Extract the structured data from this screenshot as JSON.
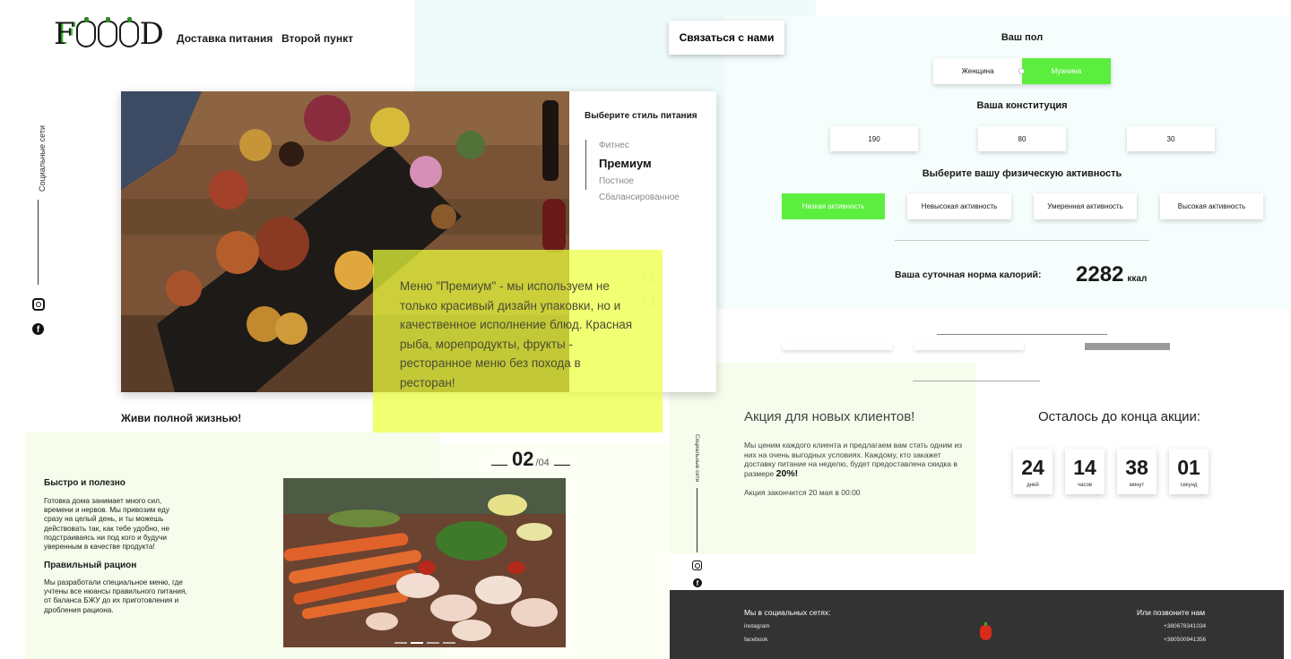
{
  "header": {
    "logo_text_f": "F",
    "logo_text_d": "D",
    "nav": [
      "Доставка питания",
      "Второй пункт"
    ],
    "contact_button": "Связаться с нами"
  },
  "social": {
    "label": "Социальные сети",
    "instagram_icon": "instagram-icon",
    "facebook_icon": "facebook-icon",
    "facebook_glyph": "f"
  },
  "hero": {
    "image": "food-platter-photo",
    "style_title": "Выберите стиль питания",
    "styles": [
      {
        "label": "Фитнес",
        "active": false
      },
      {
        "label": "Премиум",
        "active": true
      },
      {
        "label": "Постное",
        "active": false
      },
      {
        "label": "Сбалансированное",
        "active": false
      }
    ],
    "description": "Меню \"Премиум\" - мы используем не только красивый дизайн упаковки, но и качественное исполнение блюд. Красная рыба, морепродукты, фрукты - ресторанное меню без похода в ресторан!",
    "tagline": "Живи полной жизнью!"
  },
  "features": {
    "counter_current": "02",
    "counter_total": "/04",
    "items": [
      {
        "title": "Быстро и полезно",
        "text": "Готовка дома занимает много сил, времени и нервов. Мы привозим еду сразу на целый день, и ты можешь действовать так, как тебе удобно, не подстраиваясь ни под кого и будучи уверенным в качестве продукта!"
      },
      {
        "title": "Правильный рацион",
        "text": "Мы разработали специальное меню, где учтены все нюансы правильного питания, от баланса БЖУ до их приготовления и дробления рациона."
      }
    ],
    "image": "vegetables-photo",
    "slider_dots": 4,
    "slider_active": 2
  },
  "calculator": {
    "gender_label": "Ваш пол",
    "gender_options": [
      {
        "label": "Женщина",
        "selected": false
      },
      {
        "label": "Мужчина",
        "selected": true
      }
    ],
    "constitution_label": "Ваша конституция",
    "height": "190",
    "weight": "80",
    "age": "30",
    "activity_label": "Выберите вашу физическую активность",
    "activities": [
      {
        "label": "Низкая активность",
        "selected": true
      },
      {
        "label": "Невысокая активность",
        "selected": false
      },
      {
        "label": "Умеренная активность",
        "selected": false
      },
      {
        "label": "Высокая активность",
        "selected": false
      }
    ],
    "result_label": "Ваша суточная норма калорий:",
    "result_value": "2282",
    "result_unit": "ккал",
    "accent": "#5cee3e"
  },
  "promo": {
    "social_label": "Социальные сети",
    "title": "Акция для новых клиентов!",
    "text": "Мы ценим каждого клиента и предлагаем вам стать одним из них на очень выгодных условиях. Каждому, кто закажет доставку питание на неделю, будет предоставлена скидка в размере",
    "discount": "20%!",
    "end_note": "Акция закончится 20 мая в 00:00",
    "countdown_title": "Осталось до конца акции:",
    "countdown": [
      {
        "value": "24",
        "unit": "дней"
      },
      {
        "value": "14",
        "unit": "часов"
      },
      {
        "value": "38",
        "unit": "минут"
      },
      {
        "value": "01",
        "unit": "секунд"
      }
    ]
  },
  "footer": {
    "social_title": "Мы в социальных сетях:",
    "social_links": [
      "instagram",
      "facebook"
    ],
    "phone_title": "Или позвоните нам",
    "phones": [
      "+380678341034",
      "+380500941356"
    ],
    "logo_icon": "pepper-icon",
    "background": "#333333"
  }
}
